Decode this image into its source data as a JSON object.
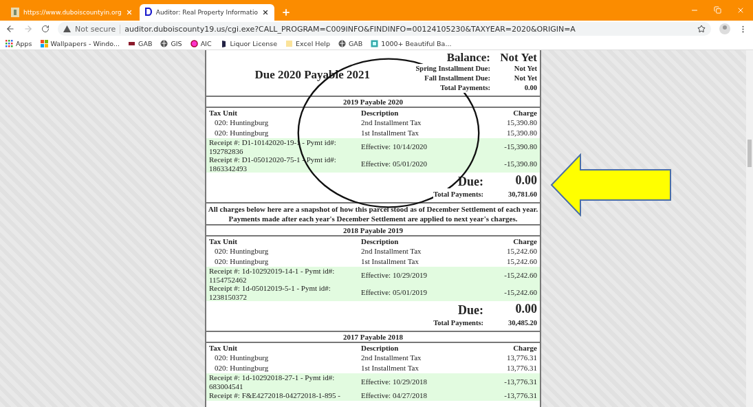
{
  "browser": {
    "tabs": [
      {
        "title": "https://www.duboiscountyin.org",
        "selected": false,
        "kind": "county"
      },
      {
        "title": "Auditor: Real Property Informatio",
        "selected": true,
        "kind": "auditor"
      }
    ],
    "security": "Not secure",
    "url": "auditor.duboiscounty19.us/cgi.exe?CALL_PROGRAM=C009INFO&FINDINFO=00124105230&TAXYEAR=2020&ORIGIN=A",
    "bookmarks": [
      {
        "label": "Apps",
        "kind": "apps"
      },
      {
        "label": "Wallpapers - Windo...",
        "kind": "windows"
      },
      {
        "label": "GAB",
        "kind": "gab"
      },
      {
        "label": "GIS",
        "kind": "globe"
      },
      {
        "label": "AIC",
        "kind": "aic"
      },
      {
        "label": "Liquor License",
        "kind": "liquor"
      },
      {
        "label": "Excel Help",
        "kind": "folder"
      },
      {
        "label": "GAB",
        "kind": "globe"
      },
      {
        "label": "1000+ Beautiful Ba...",
        "kind": "pic"
      }
    ]
  },
  "blocks": [
    {
      "kind": "summary",
      "title": "Due 2020 Payable 2021",
      "balance_label": "Balance:",
      "balance_value": "Not Yet",
      "lines": [
        {
          "label": "Spring Installment Due:",
          "value": "Not Yet"
        },
        {
          "label": "Fall Installment Due:",
          "value": "Not Yet"
        },
        {
          "label": "Total Payments:",
          "value": "0.00"
        }
      ]
    },
    {
      "kind": "year",
      "heading": "2019 Payable 2020",
      "columns": [
        "Tax Unit",
        "Description",
        "Charge"
      ],
      "rows": [
        {
          "kind": "charge",
          "tax_unit": "020: Huntingburg",
          "description": "2nd Installment Tax",
          "charge": "15,390.80"
        },
        {
          "kind": "charge",
          "tax_unit": "020: Huntingburg",
          "description": "1st Installment Tax",
          "charge": "15,390.80"
        },
        {
          "kind": "receipt",
          "tax_unit": "Receipt #: D1-10142020-19-1 - Pymt id#: 192782836",
          "description": "Effective: 10/14/2020",
          "charge": "-15,390.80"
        },
        {
          "kind": "receipt",
          "tax_unit": "Receipt #: D1-05012020-75-1 - Pymt id#: 1863342493",
          "description": "Effective: 05/01/2020",
          "charge": "-15,390.80"
        }
      ],
      "due_label": "Due:",
      "due_value": "0.00",
      "total_label": "Total Payments:",
      "total_value": "30,781.60"
    },
    {
      "kind": "note",
      "text": "All charges below here are a snapshot of how this parcel stood as of December Settlement of each year. Payments made after each year's December Settlement are applied to next year's charges."
    },
    {
      "kind": "year",
      "heading": "2018 Payable 2019",
      "columns": [
        "Tax Unit",
        "Description",
        "Charge"
      ],
      "rows": [
        {
          "kind": "charge",
          "tax_unit": "020: Huntingburg",
          "description": "2nd Installment Tax",
          "charge": "15,242.60"
        },
        {
          "kind": "charge",
          "tax_unit": "020: Huntingburg",
          "description": "1st Installment Tax",
          "charge": "15,242.60"
        },
        {
          "kind": "receipt",
          "tax_unit": "Receipt #: 1d-10292019-14-1 - Pymt id#: 1154752462",
          "description": "Effective: 10/29/2019",
          "charge": "-15,242.60"
        },
        {
          "kind": "receipt",
          "tax_unit": "Receipt #: 1d-05012019-5-1 - Pymt id#: 1238150372",
          "description": "Effective: 05/01/2019",
          "charge": "-15,242.60"
        }
      ],
      "due_label": "Due:",
      "due_value": "0.00",
      "total_label": "Total Payments:",
      "total_value": "30,485.20"
    },
    {
      "kind": "year",
      "heading": "2017 Payable 2018",
      "columns": [
        "Tax Unit",
        "Description",
        "Charge"
      ],
      "rows": [
        {
          "kind": "charge",
          "tax_unit": "020: Huntingburg",
          "description": "2nd Installment Tax",
          "charge": "13,776.31"
        },
        {
          "kind": "charge",
          "tax_unit": "020: Huntingburg",
          "description": "1st Installment Tax",
          "charge": "13,776.31"
        },
        {
          "kind": "receipt",
          "tax_unit": "Receipt #: 1d-10292018-27-1 - Pymt id#: 683004541",
          "description": "Effective: 10/29/2018",
          "charge": "-13,776.31"
        },
        {
          "kind": "receipt",
          "tax_unit": "Receipt #: F&E4272018-04272018-1-895 -",
          "description": "Effective: 04/27/2018",
          "charge": "-13,776.31"
        }
      ]
    }
  ]
}
